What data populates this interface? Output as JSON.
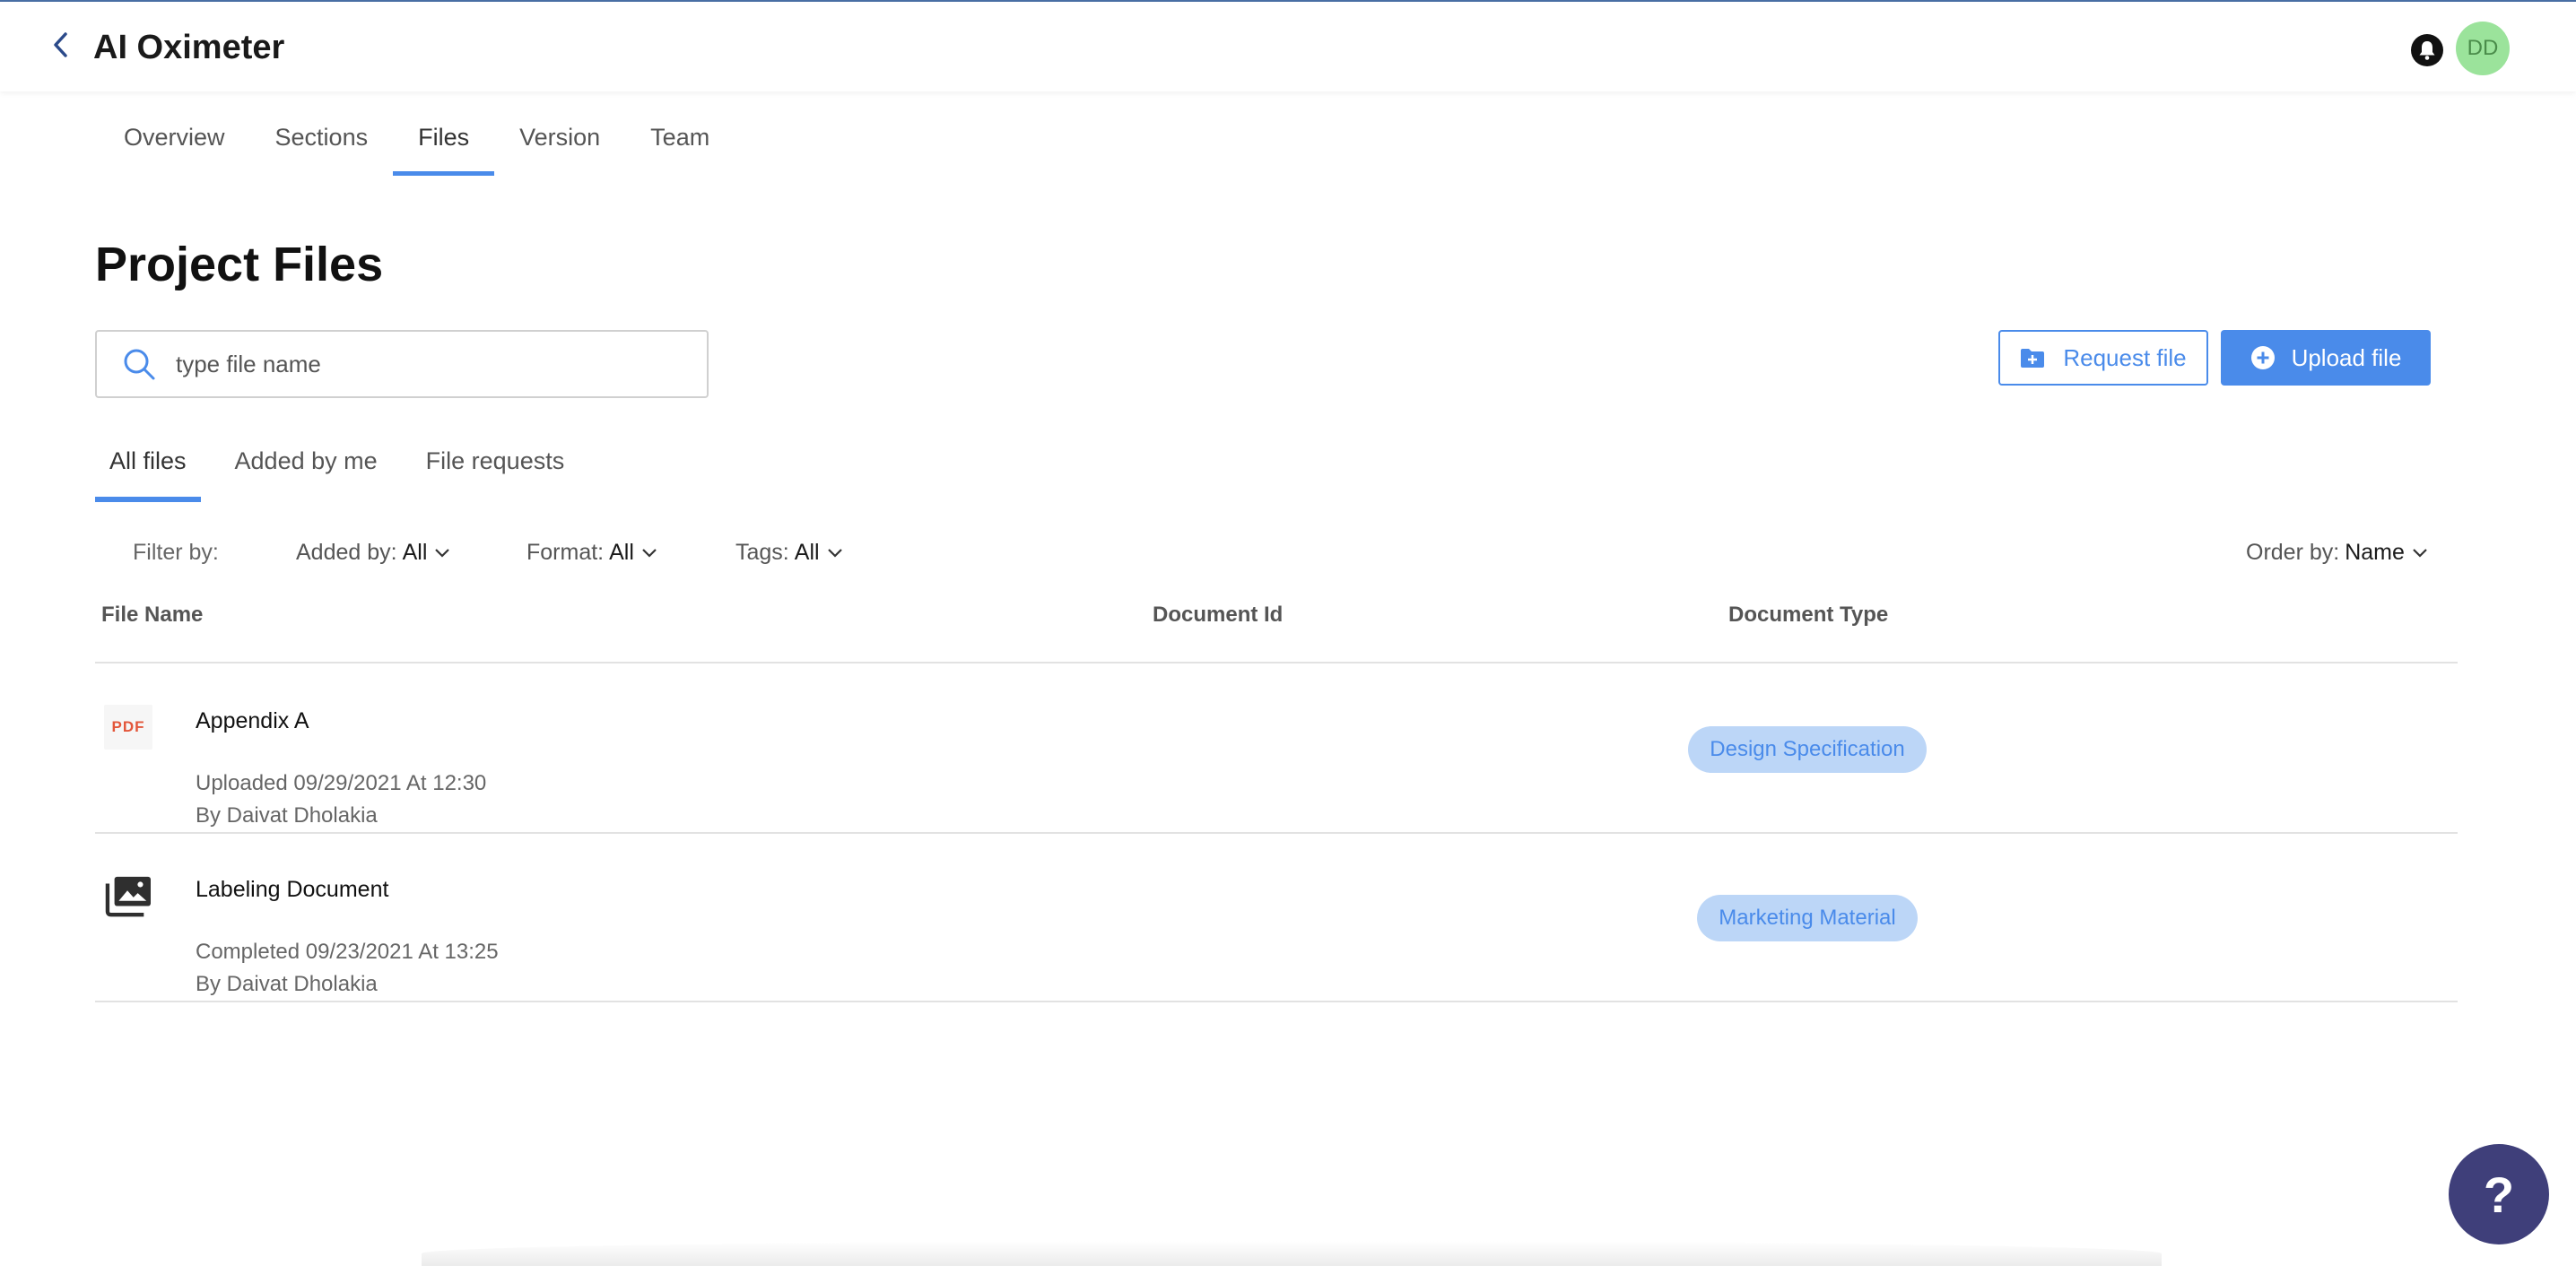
{
  "header": {
    "title": "AI Oximeter",
    "avatar_initials": "DD"
  },
  "main_tabs": [
    {
      "label": "Overview"
    },
    {
      "label": "Sections"
    },
    {
      "label": "Files",
      "active": true
    },
    {
      "label": "Version"
    },
    {
      "label": "Team"
    }
  ],
  "page": {
    "title": "Project Files"
  },
  "search": {
    "placeholder": "type file name",
    "value": ""
  },
  "actions": {
    "request_label": "Request file",
    "upload_label": "Upload file"
  },
  "sub_tabs": [
    {
      "label": "All files",
      "active": true
    },
    {
      "label": "Added by me"
    },
    {
      "label": "File requests"
    }
  ],
  "filters": {
    "label": "Filter by:",
    "added_by": {
      "label": "Added by:",
      "value": "All"
    },
    "format": {
      "label": "Format:",
      "value": "All"
    },
    "tags": {
      "label": "Tags:",
      "value": "All"
    },
    "order_by": {
      "label": "Order by:",
      "value": "Name"
    }
  },
  "table": {
    "columns": [
      "File Name",
      "Document Id",
      "Document Type"
    ],
    "rows": [
      {
        "icon": "pdf-icon",
        "icon_text": "PDF",
        "name": "Appendix A",
        "status": "Uploaded 09/29/2021 At 12:30",
        "author": "By Daivat Dholakia",
        "document_id": "",
        "document_type": "Design Specification"
      },
      {
        "icon": "image-folder-icon",
        "name": "Labeling Document",
        "status": "Completed 09/23/2021 At 13:25",
        "author": "By Daivat Dholakia",
        "document_id": "",
        "document_type": "Marketing Material"
      }
    ]
  },
  "help": {
    "label": "?"
  },
  "colors": {
    "accent": "#4a8bea",
    "badge_bg": "#bcd6f7",
    "help_bg": "#3f3f7a",
    "avatar_bg": "#9be39b",
    "pdf_red": "#e3563a"
  }
}
